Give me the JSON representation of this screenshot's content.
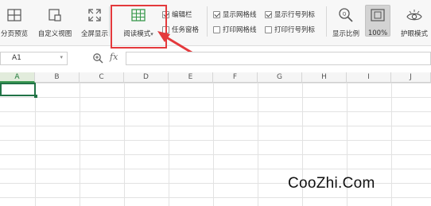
{
  "ribbon": {
    "buttons": [
      {
        "label": "分页预览",
        "icon": "page-break-preview-icon"
      },
      {
        "label": "自定义视图",
        "icon": "custom-view-icon"
      },
      {
        "label": "全屏显示",
        "icon": "fullscreen-icon"
      },
      {
        "label": "阅读模式",
        "icon": "reading-mode-icon",
        "dropdown": "▾"
      },
      {
        "label": "显示比例",
        "icon": "zoom-icon"
      },
      {
        "label": "100%",
        "icon": "zoom-100-icon"
      },
      {
        "label": "护眼模式",
        "icon": "eye-care-icon"
      }
    ],
    "checkboxes": [
      {
        "label": "编辑栏",
        "checked": true
      },
      {
        "label": "任务窗格",
        "checked": false
      },
      {
        "label": "显示网格线",
        "checked": true
      },
      {
        "label": "打印网格线",
        "checked": false
      },
      {
        "label": "显示行号列标",
        "checked": true
      },
      {
        "label": "打印行号列标",
        "checked": false
      }
    ]
  },
  "formula_bar": {
    "name_box": "A1",
    "fx_label": "fx",
    "formula_value": ""
  },
  "sheet": {
    "columns": [
      "A",
      "B",
      "C",
      "D",
      "E",
      "F",
      "G",
      "H",
      "I",
      "J"
    ],
    "selected_column": "A"
  },
  "annotation": {
    "color": "#e4393c"
  },
  "accent_color": "#217346",
  "watermark": "CooZhi.Com"
}
